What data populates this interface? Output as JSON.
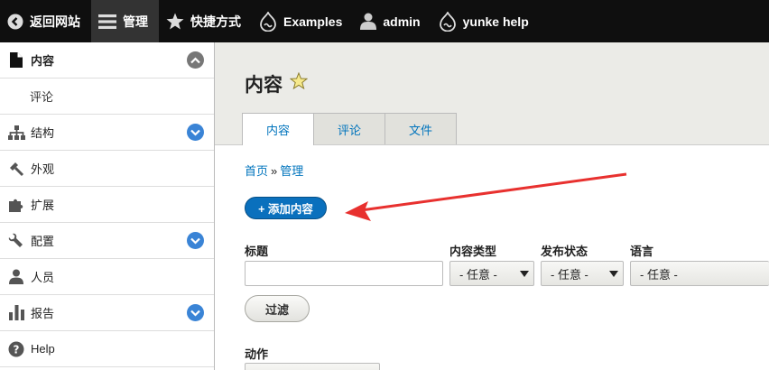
{
  "toolbar": {
    "back_label": "返回网站",
    "manage_label": "管理",
    "shortcuts_label": "快捷方式",
    "examples_label": "Examples",
    "user_label": "admin",
    "help_label": "yunke help"
  },
  "sidebar": {
    "items": [
      {
        "label": "内容"
      },
      {
        "label": "评论"
      },
      {
        "label": "结构"
      },
      {
        "label": "外观"
      },
      {
        "label": "扩展"
      },
      {
        "label": "配置"
      },
      {
        "label": "人员"
      },
      {
        "label": "报告"
      },
      {
        "label": "Help"
      }
    ]
  },
  "page": {
    "title": "内容",
    "tabs": [
      {
        "label": "内容"
      },
      {
        "label": "评论"
      },
      {
        "label": "文件"
      }
    ],
    "breadcrumb": {
      "home": "首页",
      "separator": "»",
      "current": "管理"
    },
    "add_button": "+ 添加内容"
  },
  "filters": {
    "title_label": "标题",
    "title_value": "",
    "type_label": "内容类型",
    "type_value": "- 任意 -",
    "status_label": "发布状态",
    "status_value": "- 任意 -",
    "language_label": "语言",
    "language_value": "- 任意 -",
    "filter_button": "过滤"
  },
  "actions": {
    "label": "动作"
  },
  "colors": {
    "toolbar_bg": "#0f0f0f",
    "link": "#0074bd",
    "primary_button": "#0a70bd",
    "toggle_blue": "#3a84d6",
    "annotation_arrow": "#e8312f"
  }
}
